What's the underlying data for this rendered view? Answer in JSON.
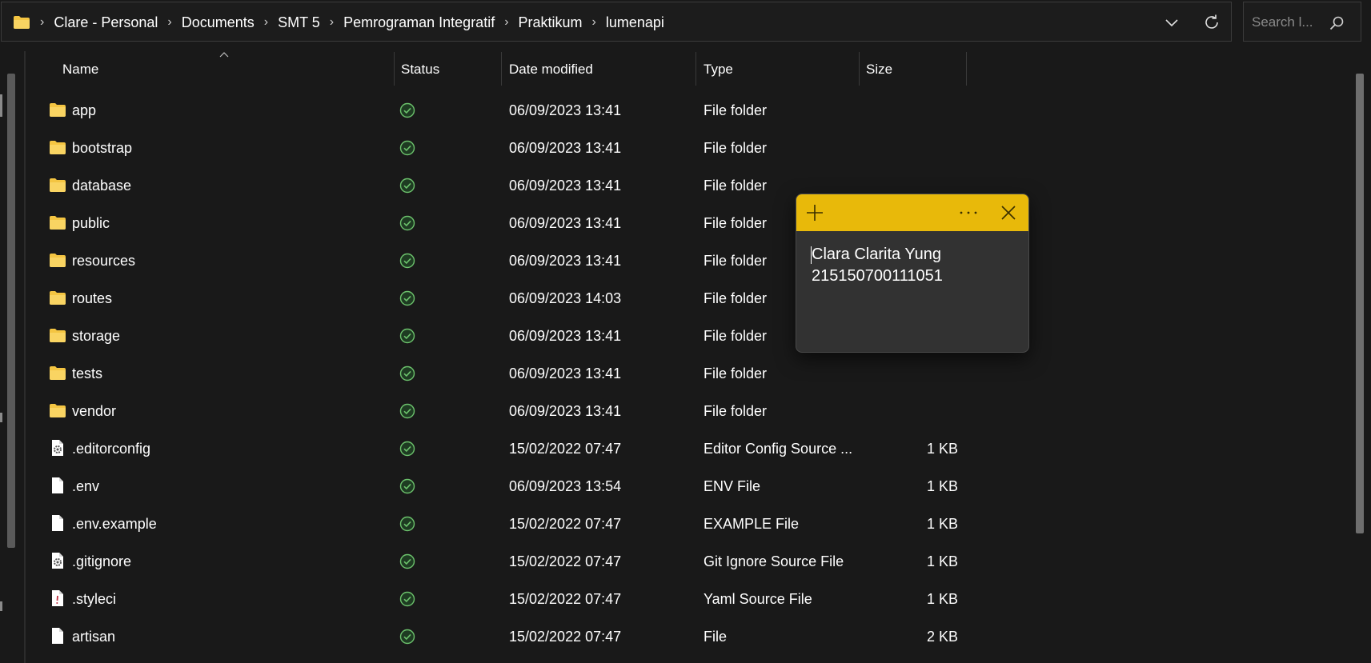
{
  "address_bar": {
    "breadcrumbs": [
      "Clare - Personal",
      "Documents",
      "SMT 5",
      "Pemrograman Integratif",
      "Praktikum",
      "lumenapi"
    ]
  },
  "search": {
    "placeholder": "Search l..."
  },
  "columns": {
    "name": "Name",
    "status": "Status",
    "date_modified": "Date modified",
    "type": "Type",
    "size": "Size"
  },
  "files": [
    {
      "name": "app",
      "date": "06/09/2023 13:41",
      "type": "File folder",
      "size": "",
      "icon": "folder-icon"
    },
    {
      "name": "bootstrap",
      "date": "06/09/2023 13:41",
      "type": "File folder",
      "size": "",
      "icon": "folder-icon"
    },
    {
      "name": "database",
      "date": "06/09/2023 13:41",
      "type": "File folder",
      "size": "",
      "icon": "folder-icon"
    },
    {
      "name": "public",
      "date": "06/09/2023 13:41",
      "type": "File folder",
      "size": "",
      "icon": "folder-icon"
    },
    {
      "name": "resources",
      "date": "06/09/2023 13:41",
      "type": "File folder",
      "size": "",
      "icon": "folder-icon"
    },
    {
      "name": "routes",
      "date": "06/09/2023 14:03",
      "type": "File folder",
      "size": "",
      "icon": "folder-icon"
    },
    {
      "name": "storage",
      "date": "06/09/2023 13:41",
      "type": "File folder",
      "size": "",
      "icon": "folder-icon"
    },
    {
      "name": "tests",
      "date": "06/09/2023 13:41",
      "type": "File folder",
      "size": "",
      "icon": "folder-icon"
    },
    {
      "name": "vendor",
      "date": "06/09/2023 13:41",
      "type": "File folder",
      "size": "",
      "icon": "folder-icon"
    },
    {
      "name": ".editorconfig",
      "date": "15/02/2022 07:47",
      "type": "Editor Config Source ...",
      "size": "1 KB",
      "icon": "config-file-icon"
    },
    {
      "name": ".env",
      "date": "06/09/2023 13:54",
      "type": "ENV File",
      "size": "1 KB",
      "icon": "file-icon"
    },
    {
      "name": ".env.example",
      "date": "15/02/2022 07:47",
      "type": "EXAMPLE File",
      "size": "1 KB",
      "icon": "file-icon"
    },
    {
      "name": ".gitignore",
      "date": "15/02/2022 07:47",
      "type": "Git Ignore Source File",
      "size": "1 KB",
      "icon": "config-file-icon"
    },
    {
      "name": ".styleci",
      "date": "15/02/2022 07:47",
      "type": "Yaml Source File",
      "size": "1 KB",
      "icon": "yaml-file-icon"
    },
    {
      "name": "artisan",
      "date": "15/02/2022 07:47",
      "type": "File",
      "size": "2 KB",
      "icon": "file-icon"
    }
  ],
  "sticky_note": {
    "lines": [
      "Clara Clarita Yung",
      "215150700111051"
    ]
  },
  "colors": {
    "background": "#191919",
    "note_header": "#e8b90a",
    "note_body": "#323232",
    "status_ok": "#6cc26c",
    "folder": "#f4c542"
  },
  "icons": {
    "status": "sync-check-icon",
    "address": "folder-icon",
    "chevron": "chevron-down-icon",
    "refresh": "refresh-icon",
    "search": "search-icon",
    "note_add": "plus-icon",
    "note_more": "more-icon",
    "note_close": "close-icon"
  }
}
